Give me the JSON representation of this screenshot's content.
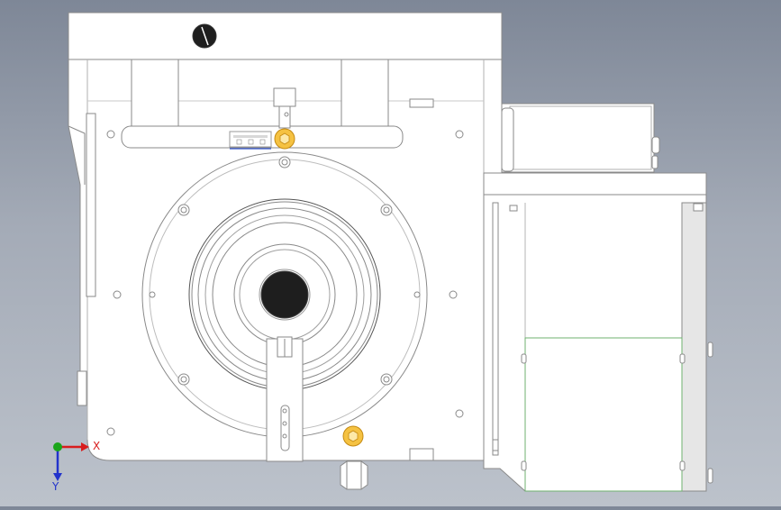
{
  "colors": {
    "background_top": "#7e8797",
    "background_bottom": "#bcc2cb",
    "part_fill": "#ffffff",
    "part_edge": "#8a8a8a",
    "bolt_highlight": "#f5c242",
    "axis_x": "#d81d1d",
    "axis_y": "#1aa51a",
    "axis_z": "#2233cc",
    "motor_cover_edge": "#6fb26f"
  },
  "icons": {
    "nameplate": "nameplate-icon",
    "bolt": "hex-bolt-icon",
    "triad": "coordinate-triad-icon"
  },
  "viewport": {
    "axis_x_label": "X",
    "axis_y_label": "Y"
  }
}
